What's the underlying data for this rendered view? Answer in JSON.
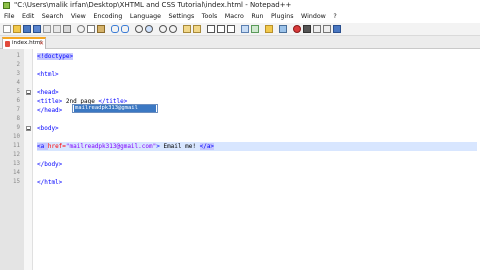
{
  "window": {
    "title": "\"C:\\Users\\malik irfan\\Desktop\\XHTML and CSS Tutorial\\index.html - Notepad++"
  },
  "menu": [
    "File",
    "Edit",
    "Search",
    "View",
    "Encoding",
    "Language",
    "Settings",
    "Tools",
    "Macro",
    "Run",
    "Plugins",
    "Window",
    "?"
  ],
  "tab": {
    "label": "index.html",
    "close": "✕"
  },
  "line_numbers": [
    "1",
    "2",
    "3",
    "4",
    "5",
    "6",
    "7",
    "8",
    "9",
    "10",
    "11",
    "12",
    "13",
    "14",
    "15"
  ],
  "code": {
    "l1": "<!doctype>",
    "l3": "<html>",
    "l5": "<head>",
    "l6_open": "<title>",
    "l6_text": " 2nd page ",
    "l6_close": "</title>",
    "l7": "</head>",
    "l9": "<body>",
    "l11_a_open": "<a ",
    "l11_attr": "href=",
    "l11_val": "\"mailreadpk313@gmail.com\"",
    "l11_gt": ">",
    "l11_text": " Email me! ",
    "l11_a_close": "</a>",
    "l13": "</body>",
    "l15": "</html>"
  },
  "autocomplete": {
    "item": "mailreadpk313@gmail"
  },
  "toolbar_icons": [
    "new-file-icon",
    "open-file-icon",
    "save-icon",
    "save-all-icon",
    "close-icon",
    "close-all-icon",
    "print-icon",
    "cut-icon",
    "copy-icon",
    "paste-icon",
    "undo-icon",
    "redo-icon",
    "find-icon",
    "replace-icon",
    "zoom-in-icon",
    "zoom-out-icon",
    "sync-v-icon",
    "sync-h-icon",
    "word-wrap-icon",
    "show-all-chars-icon",
    "indent-guide-icon",
    "doc-map-icon",
    "function-list-icon",
    "folder-workspace-icon",
    "monitor-icon",
    "record-macro-icon",
    "stop-macro-icon",
    "play-macro-icon",
    "run-macro-icon",
    "save-macro-icon"
  ]
}
